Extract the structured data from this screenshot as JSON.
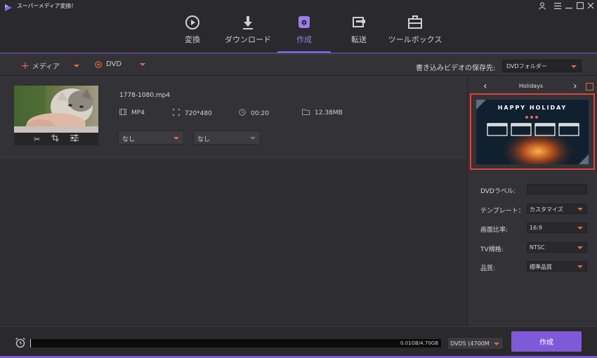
{
  "app": {
    "title": "スーパーメディア変換！"
  },
  "window_controls": [
    "user-icon",
    "menu-icon",
    "minimize-icon",
    "maximize-icon",
    "close-icon"
  ],
  "nav": {
    "tabs": [
      {
        "label": "変換",
        "icon": "convert-icon",
        "active": false
      },
      {
        "label": "ダウンロード",
        "icon": "download-icon",
        "active": false
      },
      {
        "label": "作成",
        "icon": "burn-disc-icon",
        "active": true
      },
      {
        "label": "転送",
        "icon": "transfer-icon",
        "active": false
      },
      {
        "label": "ツールボックス",
        "icon": "toolbox-icon",
        "active": false
      }
    ]
  },
  "toolbar": {
    "add_media_label": "メディア",
    "dvd_label": "DVD",
    "save_to_label": "書き込みビデオの保存先:",
    "save_to_value": "DVDフォルダー"
  },
  "media": {
    "filename": "1778-1080.mp4",
    "format": "MP4",
    "resolution": "720*480",
    "duration": "00:20",
    "size": "12.38MB",
    "subtitle_value": "なし",
    "audio_value": "なし",
    "thumbnail": "kitten-thumbnail"
  },
  "template": {
    "name": "Holidays",
    "preview_title": "HAPPY HOLIDAY"
  },
  "props": {
    "dvd_label_label": "DVDラベル:",
    "dvd_label_value": "",
    "template_label": "テンプレート：",
    "template_value": "カスタマイズ",
    "aspect_label": "画面比率:",
    "aspect_value": "16:9",
    "tv_label": "TV規格:",
    "tv_value": "NTSC",
    "quality_label": "品質:",
    "quality_value": "標準品質"
  },
  "bottom": {
    "usage_text": "0.01GB/4.70GB",
    "usage_fraction": 0.002,
    "disc_value": "DVD5 (4700M",
    "create_label": "作成"
  },
  "colors": {
    "accent_purple": "#7f5ad8",
    "accent_orange": "#e46a44",
    "highlight_red": "#d9463a"
  }
}
